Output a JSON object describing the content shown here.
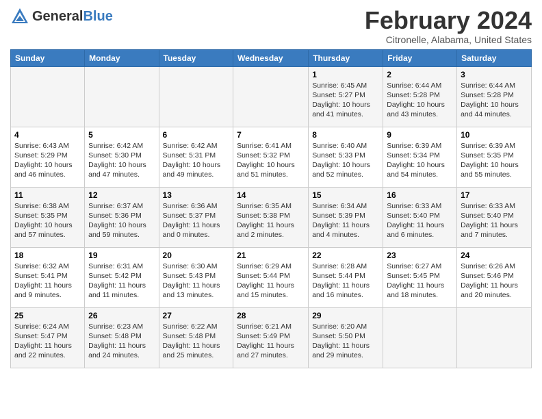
{
  "header": {
    "logo_general": "General",
    "logo_blue": "Blue",
    "title": "February 2024",
    "subtitle": "Citronelle, Alabama, United States"
  },
  "weekdays": [
    "Sunday",
    "Monday",
    "Tuesday",
    "Wednesday",
    "Thursday",
    "Friday",
    "Saturday"
  ],
  "weeks": [
    [
      {
        "day": "",
        "sunrise": "",
        "sunset": "",
        "daylight": ""
      },
      {
        "day": "",
        "sunrise": "",
        "sunset": "",
        "daylight": ""
      },
      {
        "day": "",
        "sunrise": "",
        "sunset": "",
        "daylight": ""
      },
      {
        "day": "",
        "sunrise": "",
        "sunset": "",
        "daylight": ""
      },
      {
        "day": "1",
        "sunrise": "Sunrise: 6:45 AM",
        "sunset": "Sunset: 5:27 PM",
        "daylight": "Daylight: 10 hours and 41 minutes."
      },
      {
        "day": "2",
        "sunrise": "Sunrise: 6:44 AM",
        "sunset": "Sunset: 5:28 PM",
        "daylight": "Daylight: 10 hours and 43 minutes."
      },
      {
        "day": "3",
        "sunrise": "Sunrise: 6:44 AM",
        "sunset": "Sunset: 5:28 PM",
        "daylight": "Daylight: 10 hours and 44 minutes."
      }
    ],
    [
      {
        "day": "4",
        "sunrise": "Sunrise: 6:43 AM",
        "sunset": "Sunset: 5:29 PM",
        "daylight": "Daylight: 10 hours and 46 minutes."
      },
      {
        "day": "5",
        "sunrise": "Sunrise: 6:42 AM",
        "sunset": "Sunset: 5:30 PM",
        "daylight": "Daylight: 10 hours and 47 minutes."
      },
      {
        "day": "6",
        "sunrise": "Sunrise: 6:42 AM",
        "sunset": "Sunset: 5:31 PM",
        "daylight": "Daylight: 10 hours and 49 minutes."
      },
      {
        "day": "7",
        "sunrise": "Sunrise: 6:41 AM",
        "sunset": "Sunset: 5:32 PM",
        "daylight": "Daylight: 10 hours and 51 minutes."
      },
      {
        "day": "8",
        "sunrise": "Sunrise: 6:40 AM",
        "sunset": "Sunset: 5:33 PM",
        "daylight": "Daylight: 10 hours and 52 minutes."
      },
      {
        "day": "9",
        "sunrise": "Sunrise: 6:39 AM",
        "sunset": "Sunset: 5:34 PM",
        "daylight": "Daylight: 10 hours and 54 minutes."
      },
      {
        "day": "10",
        "sunrise": "Sunrise: 6:39 AM",
        "sunset": "Sunset: 5:35 PM",
        "daylight": "Daylight: 10 hours and 55 minutes."
      }
    ],
    [
      {
        "day": "11",
        "sunrise": "Sunrise: 6:38 AM",
        "sunset": "Sunset: 5:35 PM",
        "daylight": "Daylight: 10 hours and 57 minutes."
      },
      {
        "day": "12",
        "sunrise": "Sunrise: 6:37 AM",
        "sunset": "Sunset: 5:36 PM",
        "daylight": "Daylight: 10 hours and 59 minutes."
      },
      {
        "day": "13",
        "sunrise": "Sunrise: 6:36 AM",
        "sunset": "Sunset: 5:37 PM",
        "daylight": "Daylight: 11 hours and 0 minutes."
      },
      {
        "day": "14",
        "sunrise": "Sunrise: 6:35 AM",
        "sunset": "Sunset: 5:38 PM",
        "daylight": "Daylight: 11 hours and 2 minutes."
      },
      {
        "day": "15",
        "sunrise": "Sunrise: 6:34 AM",
        "sunset": "Sunset: 5:39 PM",
        "daylight": "Daylight: 11 hours and 4 minutes."
      },
      {
        "day": "16",
        "sunrise": "Sunrise: 6:33 AM",
        "sunset": "Sunset: 5:40 PM",
        "daylight": "Daylight: 11 hours and 6 minutes."
      },
      {
        "day": "17",
        "sunrise": "Sunrise: 6:33 AM",
        "sunset": "Sunset: 5:40 PM",
        "daylight": "Daylight: 11 hours and 7 minutes."
      }
    ],
    [
      {
        "day": "18",
        "sunrise": "Sunrise: 6:32 AM",
        "sunset": "Sunset: 5:41 PM",
        "daylight": "Daylight: 11 hours and 9 minutes."
      },
      {
        "day": "19",
        "sunrise": "Sunrise: 6:31 AM",
        "sunset": "Sunset: 5:42 PM",
        "daylight": "Daylight: 11 hours and 11 minutes."
      },
      {
        "day": "20",
        "sunrise": "Sunrise: 6:30 AM",
        "sunset": "Sunset: 5:43 PM",
        "daylight": "Daylight: 11 hours and 13 minutes."
      },
      {
        "day": "21",
        "sunrise": "Sunrise: 6:29 AM",
        "sunset": "Sunset: 5:44 PM",
        "daylight": "Daylight: 11 hours and 15 minutes."
      },
      {
        "day": "22",
        "sunrise": "Sunrise: 6:28 AM",
        "sunset": "Sunset: 5:44 PM",
        "daylight": "Daylight: 11 hours and 16 minutes."
      },
      {
        "day": "23",
        "sunrise": "Sunrise: 6:27 AM",
        "sunset": "Sunset: 5:45 PM",
        "daylight": "Daylight: 11 hours and 18 minutes."
      },
      {
        "day": "24",
        "sunrise": "Sunrise: 6:26 AM",
        "sunset": "Sunset: 5:46 PM",
        "daylight": "Daylight: 11 hours and 20 minutes."
      }
    ],
    [
      {
        "day": "25",
        "sunrise": "Sunrise: 6:24 AM",
        "sunset": "Sunset: 5:47 PM",
        "daylight": "Daylight: 11 hours and 22 minutes."
      },
      {
        "day": "26",
        "sunrise": "Sunrise: 6:23 AM",
        "sunset": "Sunset: 5:48 PM",
        "daylight": "Daylight: 11 hours and 24 minutes."
      },
      {
        "day": "27",
        "sunrise": "Sunrise: 6:22 AM",
        "sunset": "Sunset: 5:48 PM",
        "daylight": "Daylight: 11 hours and 25 minutes."
      },
      {
        "day": "28",
        "sunrise": "Sunrise: 6:21 AM",
        "sunset": "Sunset: 5:49 PM",
        "daylight": "Daylight: 11 hours and 27 minutes."
      },
      {
        "day": "29",
        "sunrise": "Sunrise: 6:20 AM",
        "sunset": "Sunset: 5:50 PM",
        "daylight": "Daylight: 11 hours and 29 minutes."
      },
      {
        "day": "",
        "sunrise": "",
        "sunset": "",
        "daylight": ""
      },
      {
        "day": "",
        "sunrise": "",
        "sunset": "",
        "daylight": ""
      }
    ]
  ]
}
